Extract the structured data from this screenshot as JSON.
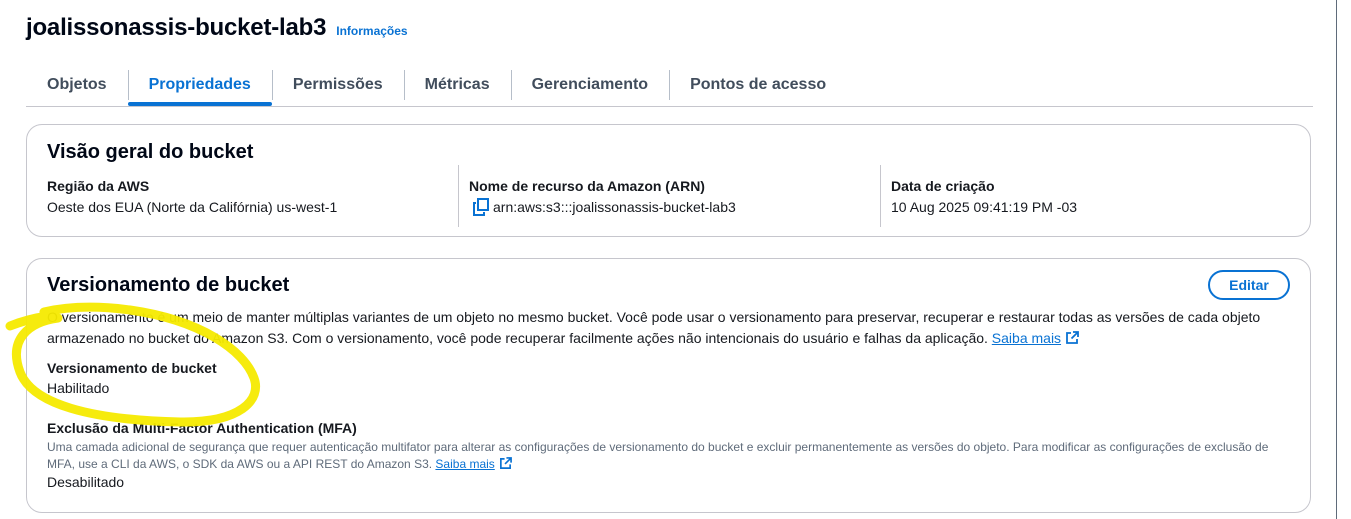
{
  "header": {
    "bucket_name": "joalissonassis-bucket-lab3",
    "info_link": "Informações"
  },
  "tabs": [
    {
      "label": "Objetos",
      "active": false
    },
    {
      "label": "Propriedades",
      "active": true
    },
    {
      "label": "Permissões",
      "active": false
    },
    {
      "label": "Métricas",
      "active": false
    },
    {
      "label": "Gerenciamento",
      "active": false
    },
    {
      "label": "Pontos de acesso",
      "active": false
    }
  ],
  "overview": {
    "title": "Visão geral do bucket",
    "region_label": "Região da AWS",
    "region_value": "Oeste dos EUA (Norte da Califórnia) us-west-1",
    "arn_label": "Nome de recurso da Amazon (ARN)",
    "arn_value": "arn:aws:s3:::joalissonassis-bucket-lab3",
    "created_label": "Data de criação",
    "created_value": "10 Aug 2025 09:41:19 PM -03"
  },
  "versioning": {
    "title": "Versionamento de bucket",
    "edit_label": "Editar",
    "description": "O versionamento é um meio de manter múltiplas variantes de um objeto no mesmo bucket. Você pode usar o versionamento para preservar, recuperar e restaurar todas as versões de cada objeto armazenado no bucket do Amazon S3. Com o versionamento, você pode recuperar facilmente ações não intencionais do usuário e falhas da aplicação.",
    "learn_more": "Saiba mais",
    "status_label": "Versionamento de bucket",
    "status_value": "Habilitado",
    "mfa_label": "Exclusão da Multi-Factor Authentication (MFA)",
    "mfa_description": "Uma camada adicional de segurança que requer autenticação multifator para alterar as configurações de versionamento do bucket e excluir permanentemente as versões do objeto. Para modificar as configurações de exclusão de MFA, use a CLI da AWS, o SDK da AWS ou a API REST do Amazon S3.",
    "mfa_learn_more": "Saiba mais",
    "mfa_value": "Desabilitado"
  },
  "colors": {
    "accent": "#0972d3",
    "highlight": "#f5ea00"
  },
  "icons": {
    "copy": "copy-icon",
    "external": "external-link-icon"
  }
}
